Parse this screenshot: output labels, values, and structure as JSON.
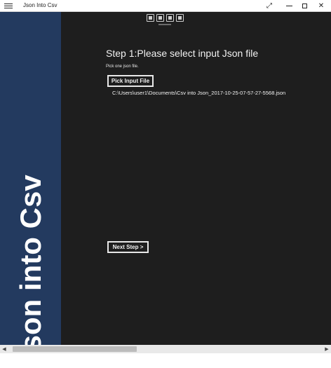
{
  "window": {
    "title": "Json Into Csv",
    "controls": {
      "expand": "⤢",
      "close": "✕"
    }
  },
  "sidebar": {
    "vertical_title": "Json into Csv",
    "color": "#233a5f"
  },
  "toolbar": {
    "icons": [
      "export-icon",
      "cast-icon",
      "fit-icon",
      "fullscreen-icon"
    ]
  },
  "main": {
    "step_title": "Step 1:Please select input Json file",
    "step_subtitle": "Pick one json file.",
    "pick_button_label": "Pick Input File",
    "selected_file_path": "C:\\Users\\user1\\Documents\\Csv into Json_2017-10-25-07-57-27-5568.json",
    "next_button_label": "Next Step >"
  },
  "scrollbar": {
    "left_arrow": "◀",
    "right_arrow": "▶"
  },
  "colors": {
    "background": "#1e1e1e",
    "text": "#f2f2f2",
    "button_border": "#e8e8e8"
  }
}
